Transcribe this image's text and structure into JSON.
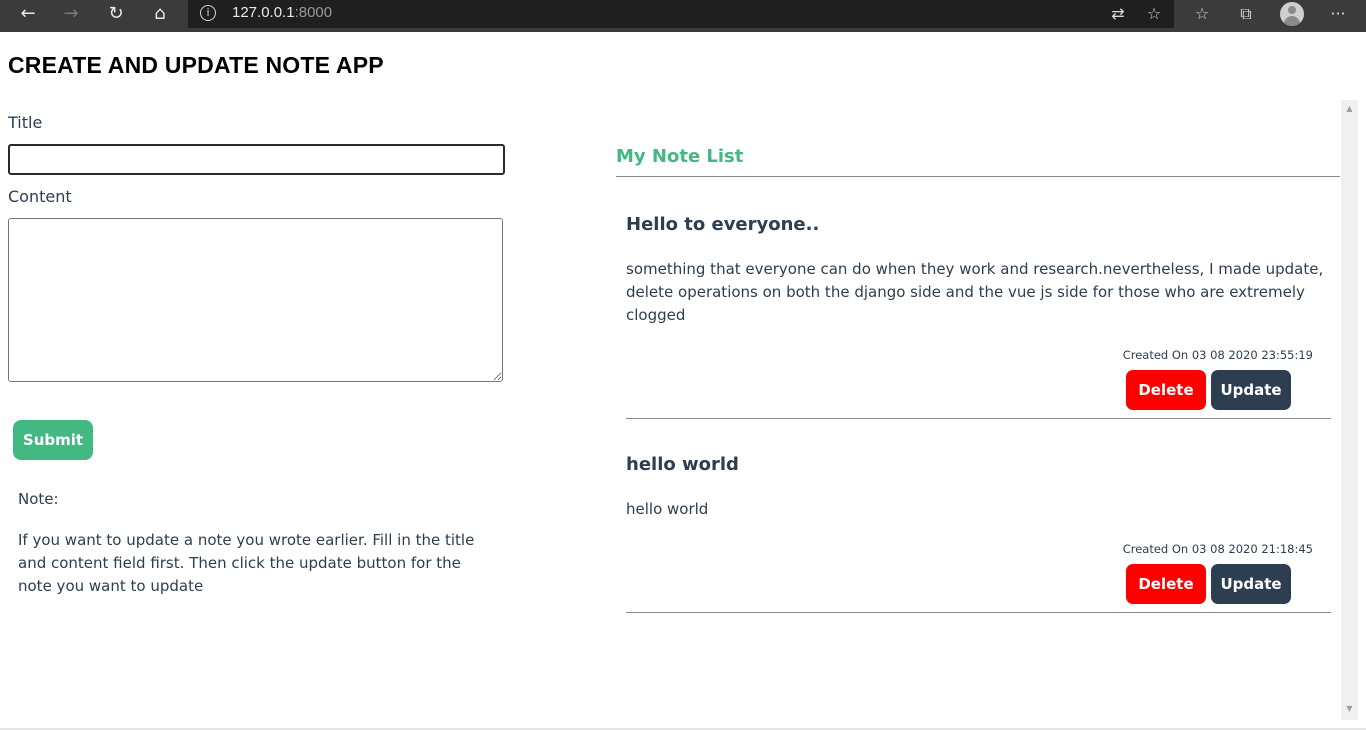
{
  "browser": {
    "url_host": "127.0.0.1",
    "url_port": ":8000",
    "back_icon": "←",
    "forward_icon": "→",
    "reload_icon": "↻",
    "home_icon": "⌂",
    "info_icon": "i",
    "translate_icon": "⇄",
    "favorite_icon": "☆",
    "favorites_bar_icon": "☆",
    "collections_icon": "⧉",
    "more_icon": "···"
  },
  "app": {
    "title": "CREATE AND UPDATE NOTE APP",
    "form": {
      "title_label": "Title",
      "title_value": "",
      "content_label": "Content",
      "content_value": "",
      "submit_label": "Submit"
    },
    "help": {
      "heading": "Note:",
      "text": "If you want to update a note you wrote earlier. Fill in the title and content field first. Then click the update button for the note you want to update"
    },
    "list": {
      "title": "My Note List",
      "notes": [
        {
          "title": "Hello to everyone..",
          "body": "something that everyone can do when they work and research.nevertheless, I made update, delete operations on both the django side and the vue js side for those who are extremely clogged",
          "created": "Created On 03 08 2020 23:55:19",
          "delete_label": "Delete",
          "update_label": "Update"
        },
        {
          "title": "hello world",
          "body": "hello world",
          "created": "Created On 03 08 2020 21:18:45",
          "delete_label": "Delete",
          "update_label": "Update"
        }
      ]
    }
  },
  "colors": {
    "accent_green": "#42b983",
    "delete_red": "#ff0000",
    "update_navy": "#2c3e50"
  }
}
